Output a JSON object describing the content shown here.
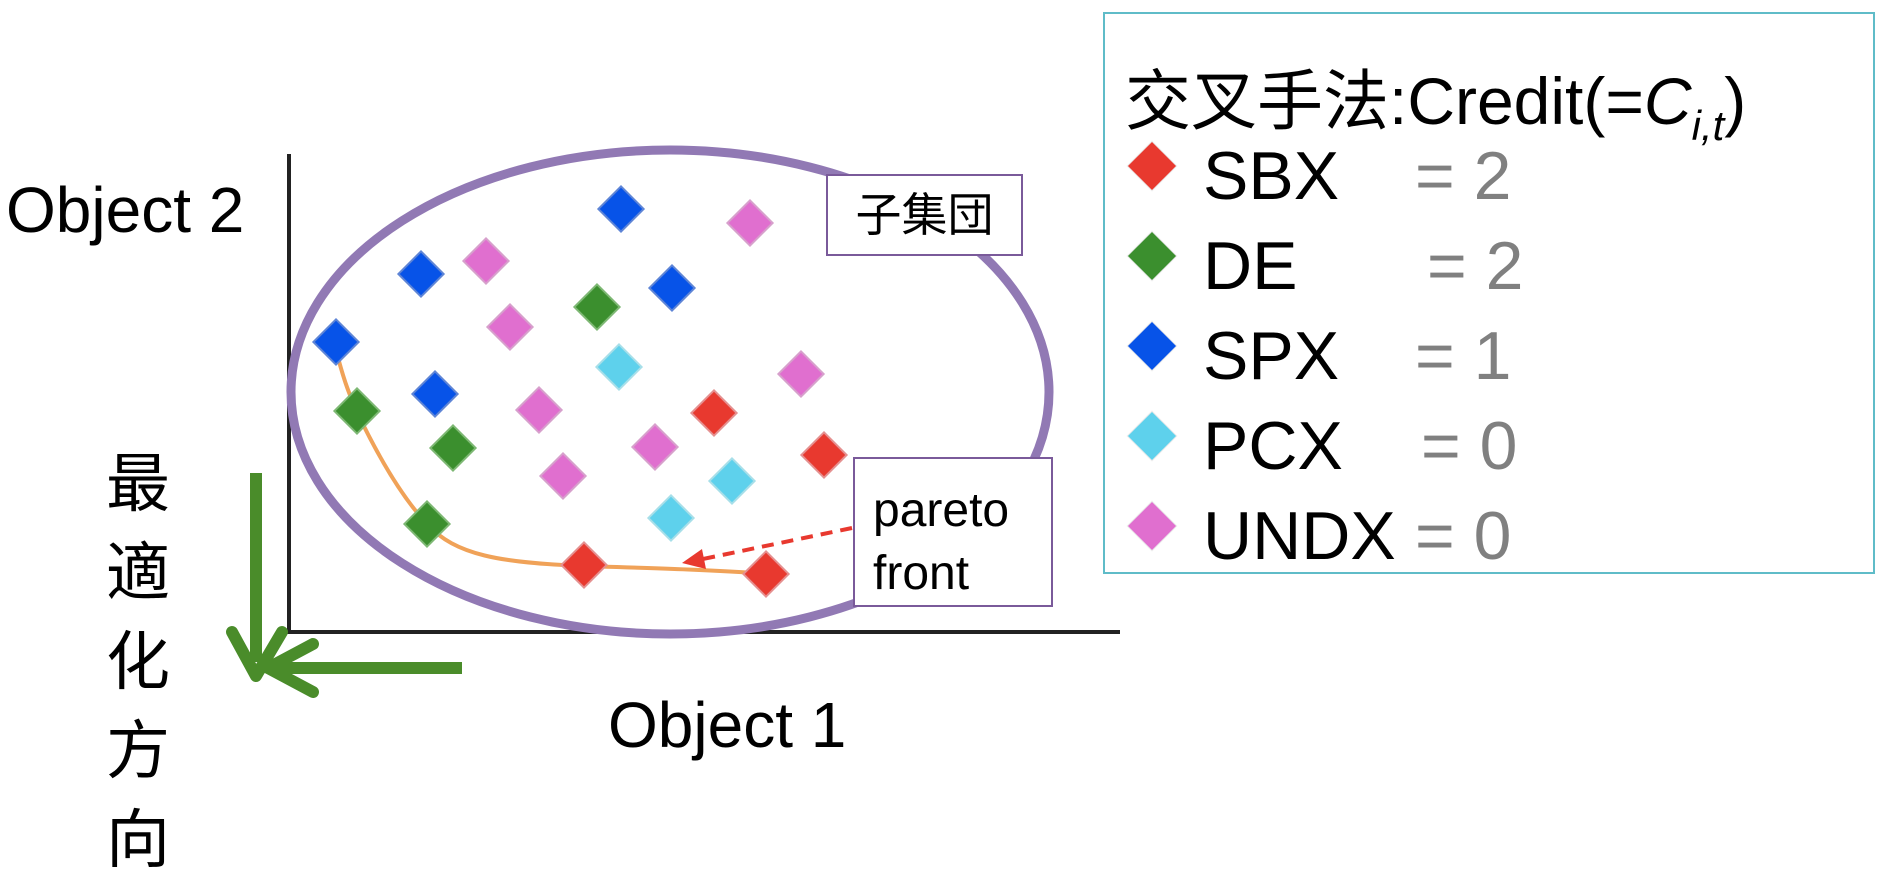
{
  "labels": {
    "y_axis": "Object 2",
    "x_axis": "Object 1",
    "optimization_direction": [
      "最",
      "適",
      "化",
      "方",
      "向"
    ],
    "subpopulation": "子集団",
    "pareto_front": [
      "pareto",
      "front"
    ]
  },
  "legend": {
    "title_prefix": "交叉手法:Credit(=",
    "title_var": "C",
    "title_sub": "i,t",
    "title_suffix": ")",
    "entries": [
      {
        "name": "SBX",
        "eq": "= 2",
        "color": "#e8392f"
      },
      {
        "name": "DE",
        "eq": "= 2",
        "color": "#3b8f2e"
      },
      {
        "name": "SPX",
        "eq": "= 1",
        "color": "#0753e8"
      },
      {
        "name": "PCX",
        "eq": "= 0",
        "color": "#5ed1ec"
      },
      {
        "name": "UNDX",
        "eq": "= 0",
        "color": "#e06fcf"
      }
    ]
  },
  "colors": {
    "ellipse": "#9179b4",
    "front_curve": "#f0a258",
    "arrow_green": "#4a8c2a",
    "pointer": "#e8392f",
    "legend_border": "#5fbcc8"
  }
}
